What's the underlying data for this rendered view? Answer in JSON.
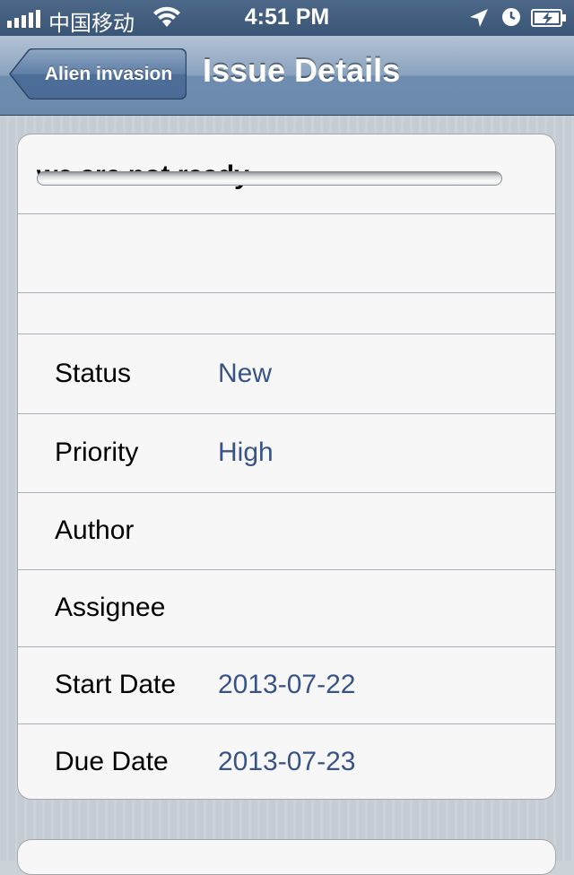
{
  "status_bar": {
    "carrier": "中国移动",
    "time": "4:51 PM",
    "signal_icon": "signal-bars-icon",
    "wifi_icon": "wifi-icon",
    "location_icon": "location-arrow-icon",
    "alarm_icon": "clock-icon",
    "battery_icon": "battery-charging-icon"
  },
  "nav": {
    "back_label": "Alien invasion",
    "title": "Issue Details"
  },
  "issue": {
    "subject": "we are not ready",
    "description": "",
    "progress_percent": 0
  },
  "fields": [
    {
      "label": "Status",
      "value": "New"
    },
    {
      "label": "Priority",
      "value": "High"
    },
    {
      "label": "Author",
      "value": ""
    },
    {
      "label": "Assignee",
      "value": ""
    },
    {
      "label": "Start Date",
      "value": "2013-07-22"
    },
    {
      "label": "Due Date",
      "value": "2013-07-23"
    }
  ],
  "colors": {
    "value_text": "#385487",
    "nav_bar": "#6f8db0",
    "status_bar": "#3f5a78"
  }
}
